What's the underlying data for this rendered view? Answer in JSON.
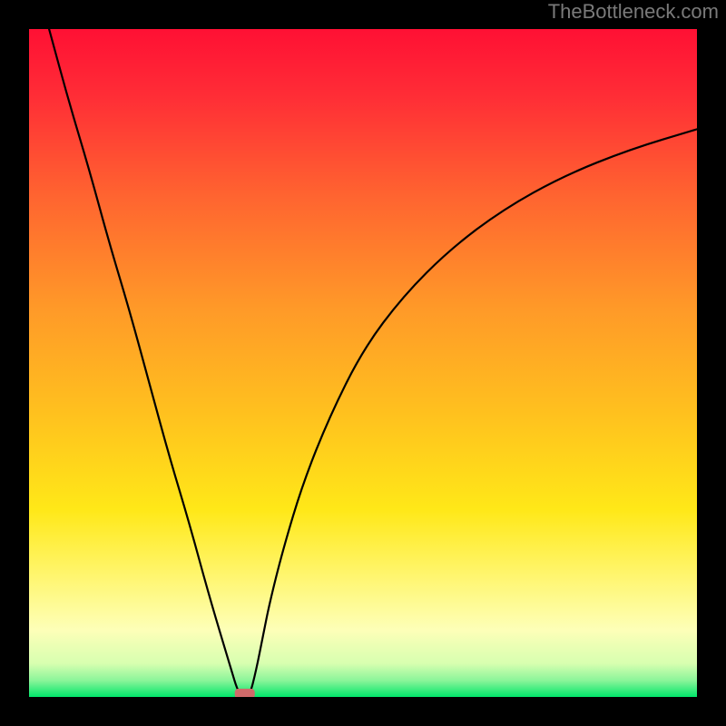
{
  "watermark": "TheBottleneck.com",
  "chart_data": {
    "type": "line",
    "title": "",
    "xlabel": "",
    "ylabel": "",
    "xlim": [
      0,
      1
    ],
    "ylim": [
      0,
      1
    ],
    "grid": false,
    "legend": false,
    "annotations": [],
    "background_gradient": {
      "top_color": "#ff1a3a",
      "mid_color": "#ffe818",
      "bottom_color_band": "#00e66a",
      "transition": "vertical linear red→orange→yellow→pale-yellow, thin green strip at very bottom"
    },
    "series": [
      {
        "name": "curve",
        "color": "#000000",
        "x": [
          0.03,
          0.06,
          0.09,
          0.12,
          0.15,
          0.18,
          0.21,
          0.24,
          0.27,
          0.3,
          0.315,
          0.33,
          0.34,
          0.35,
          0.36,
          0.38,
          0.41,
          0.45,
          0.5,
          0.56,
          0.63,
          0.71,
          0.8,
          0.9,
          1.0
        ],
        "y": [
          1.0,
          0.89,
          0.79,
          0.68,
          0.58,
          0.47,
          0.36,
          0.26,
          0.15,
          0.05,
          0.0,
          0.0,
          0.04,
          0.09,
          0.14,
          0.22,
          0.32,
          0.42,
          0.52,
          0.6,
          0.67,
          0.73,
          0.78,
          0.82,
          0.85
        ]
      }
    ],
    "markers": [
      {
        "name": "minimum-marker",
        "shape": "small-rounded-rect",
        "x": 0.323,
        "y": 0.005,
        "color": "#d06a6a"
      }
    ]
  }
}
